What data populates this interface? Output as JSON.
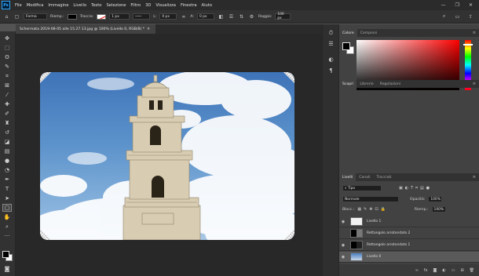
{
  "app": {
    "logo": "Ps",
    "window_controls": [
      "—",
      "❐",
      "✕"
    ]
  },
  "menu": [
    "File",
    "Modifica",
    "Immagine",
    "Livello",
    "Testo",
    "Selezione",
    "Filtro",
    "3D",
    "Visualizza",
    "Finestra",
    "Aiuto"
  ],
  "options": {
    "mode": "Forma",
    "fill_label": "Riemp.:",
    "stroke_label": "Traccia:",
    "stroke_width": "1 px",
    "l_label": "L:",
    "l_value": "0 px",
    "a_label": "A:",
    "a_value": "0 px",
    "radius_label": "Raggio:",
    "radius_value": "100 px"
  },
  "document": {
    "tab_title": "Schermata 2019-08-05 alle 15.27.13.jpg @ 100% (Livello 0, RGB/8) *",
    "tab_close": "✕"
  },
  "color_panel": {
    "tabs": [
      "Colore",
      "Campioni"
    ]
  },
  "props_panel": {
    "tabs": [
      "Scopri",
      "Librerie",
      "Regolazioni"
    ]
  },
  "layers_panel": {
    "tabs": [
      "Livelli",
      "Canali",
      "Tracciati"
    ],
    "filter": "Tipo",
    "blend_mode": "Normale",
    "opacity_label": "Opacità:",
    "opacity_value": "100%",
    "lock_label": "Blocc.:",
    "fill_label": "Riemp.:",
    "fill_value": "100%",
    "layers": [
      {
        "name": "Livello 1",
        "visible": true,
        "selected": false
      },
      {
        "name": "Rettangolo arrotondato 2",
        "visible": false,
        "selected": false
      },
      {
        "name": "Rettangolo arrotondato 1",
        "visible": true,
        "selected": false
      },
      {
        "name": "Livello 0",
        "visible": true,
        "selected": true
      }
    ]
  }
}
